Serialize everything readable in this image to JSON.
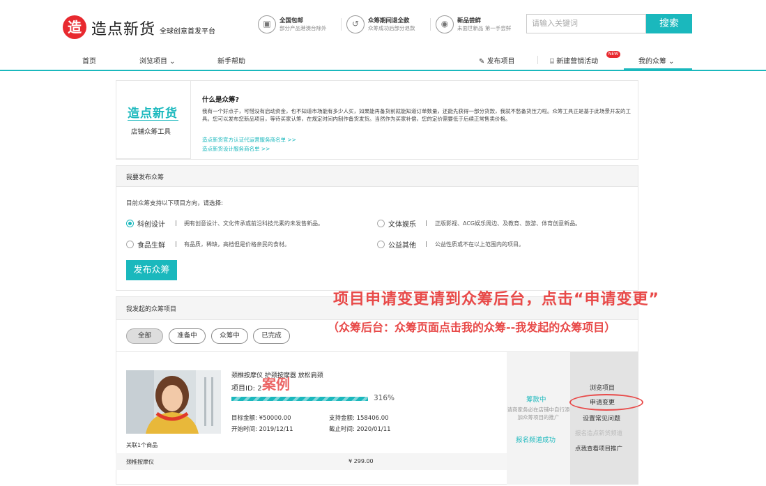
{
  "header": {
    "logo_mark": "造",
    "logo_name": "造点新货",
    "logo_sub": "全球创意首发平台",
    "features": [
      {
        "icon": "truck-icon",
        "glyph": "▣",
        "title": "全国包邮",
        "sub": "部分产品港澳台除外"
      },
      {
        "icon": "refund-icon",
        "glyph": "↺",
        "title": "众筹期间退全款",
        "sub": "众筹成功后部分退款"
      },
      {
        "icon": "sound-icon",
        "glyph": "◉",
        "title": "新品尝鲜",
        "sub": "未面世新品 第一手尝鲜"
      }
    ],
    "search": {
      "placeholder": "请输入关键词",
      "button": "搜索"
    }
  },
  "nav": {
    "home": "首页",
    "browse": "浏览项目",
    "help": "新手帮助",
    "publish": "发布项目",
    "marketing": "新建营销活动",
    "new_badge": "NEW",
    "mine": "我的众筹",
    "accent": "#1ab8bd"
  },
  "info": {
    "brand_title": "造点新货",
    "brand_sub": "店铺众筹工具",
    "question": "什么是众筹?",
    "paragraph": "我有一个好点子，可惜没有启动资金，也不知道市场能有多少人买，如果能再备货前就能知道订单数量，还能先获得一部分货款，我就不愁备货压力啦。众筹工具正是基于此场景开发的工具。您可以发布您新品项目，等待买家认筹，在规定时间内制作备货发货。当然作为买家补偿，您的定价需要低于后续正常售卖价格。",
    "link1": "造点新货官方认证代运营服务商名单 >>",
    "link2": "造点新货设计服务商名单 >>"
  },
  "launch": {
    "title": "我要发布众筹",
    "intro": "目前众筹支持以下项目方向，请选择:",
    "options": [
      {
        "name": "科创设计",
        "desc": "拥有创意设计、文化传承或前沿科技元素的未发售新品。",
        "selected": true
      },
      {
        "name": "文体娱乐",
        "desc": "正版影视、ACG娱乐周边、及教育、旅游、体育创意新品。",
        "selected": false
      },
      {
        "name": "食品生鲜",
        "desc": "有品质，稀缺，高档但是价格亲民的食材。",
        "selected": false
      },
      {
        "name": "公益其他",
        "desc": "公益性质或不在以上范围内的项目。",
        "selected": false
      }
    ],
    "sep": "|",
    "button": "发布众筹"
  },
  "projects": {
    "title": "我发起的众筹项目",
    "filters": [
      "全部",
      "准备中",
      "众筹中",
      "已完成"
    ],
    "item": {
      "name": "颈椎按摩仪 护颈按摩器 放松肩颈",
      "id_label": "项目ID: 2",
      "progress_text": "316%",
      "progress": 3.16,
      "target_label": "目标金额: ¥50000.00",
      "support_label": "支持金额: 158406.00",
      "start_label": "开始时间: 2019/12/11",
      "end_label": "截止时间: 2020/01/11",
      "status": "筹款中",
      "status_note": "请商家务必在店铺中自行添加众筹项目的推广",
      "channel_status": "报名频道成功",
      "actions": [
        "浏览项目",
        "申请变更",
        "设置常见问题",
        "报名造点新货频道",
        "点我查看项目推广"
      ],
      "related": "关联1个商品",
      "product_name": "颈椎按摩仪",
      "product_price": "¥ 299.00"
    }
  },
  "annotations": {
    "main": "项目申请变更请到众筹后台，点击“申请变更”",
    "sub": "（众筹后台：众筹页面点击我的众筹--我发起的众筹项目）",
    "case": "案例"
  }
}
